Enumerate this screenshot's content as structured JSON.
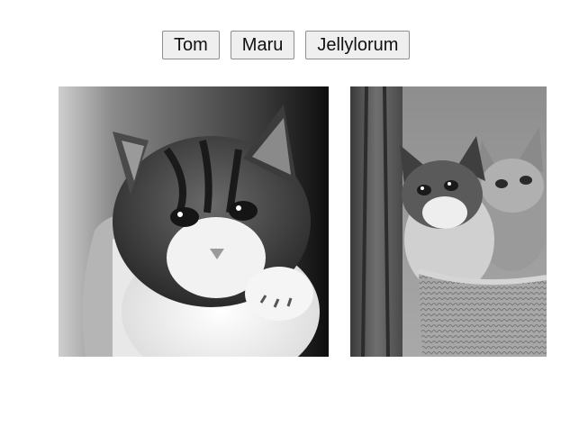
{
  "buttons": [
    {
      "label": "Tom"
    },
    {
      "label": "Maru"
    },
    {
      "label": "Jellylorum"
    }
  ],
  "images": [
    {
      "subject": "grayscale-kitten-photo"
    },
    {
      "subject": "grayscale-two-kittens-in-basket-photo"
    }
  ]
}
